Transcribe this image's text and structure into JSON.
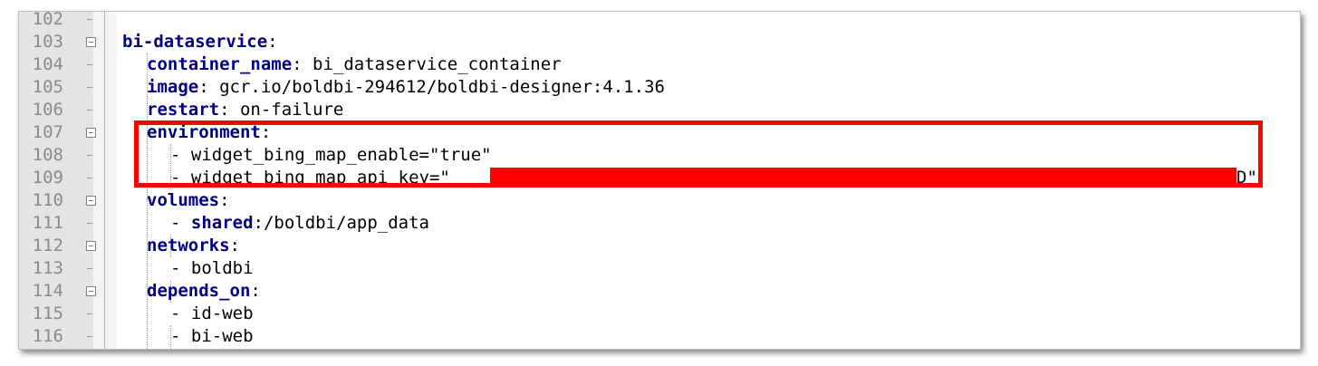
{
  "editor": {
    "lines": [
      {
        "num": "102",
        "key": "",
        "text": ""
      },
      {
        "num": "103",
        "key": "bi-dataservice",
        "sep": ":",
        "text": ""
      },
      {
        "num": "104",
        "key": "container_name",
        "sep": ":",
        "text": " bi_dataservice_container"
      },
      {
        "num": "105",
        "key": "image",
        "sep": ":",
        "text": " gcr.io/boldbi-294612/boldbi-designer:4.1.36"
      },
      {
        "num": "106",
        "key": "restart",
        "sep": ":",
        "text": " on-failure"
      },
      {
        "num": "107",
        "key": "environment",
        "sep": ":",
        "text": ""
      },
      {
        "num": "108",
        "key": "",
        "sep": "",
        "text": "- widget_bing_map_enable=\"true\""
      },
      {
        "num": "109",
        "key": "",
        "sep": "",
        "text": "- widget_bing_map_api_key=\"",
        "tail": "D\""
      },
      {
        "num": "110",
        "key": "volumes",
        "sep": ":",
        "text": ""
      },
      {
        "num": "111",
        "key": "",
        "sep": "",
        "text": ":/boldbi/app_data",
        "prefix": "- ",
        "inlinekey": "shared"
      },
      {
        "num": "112",
        "key": "networks",
        "sep": ":",
        "text": ""
      },
      {
        "num": "113",
        "key": "",
        "sep": "",
        "text": "- boldbi"
      },
      {
        "num": "114",
        "key": "depends_on",
        "sep": ":",
        "text": ""
      },
      {
        "num": "115",
        "key": "",
        "sep": "",
        "text": "- id-web"
      },
      {
        "num": "116",
        "key": "",
        "sep": "",
        "text": "- bi-web"
      }
    ]
  },
  "colors": {
    "highlight_border": "#ff0000",
    "redaction": "#ff0000",
    "key": "#000080"
  }
}
